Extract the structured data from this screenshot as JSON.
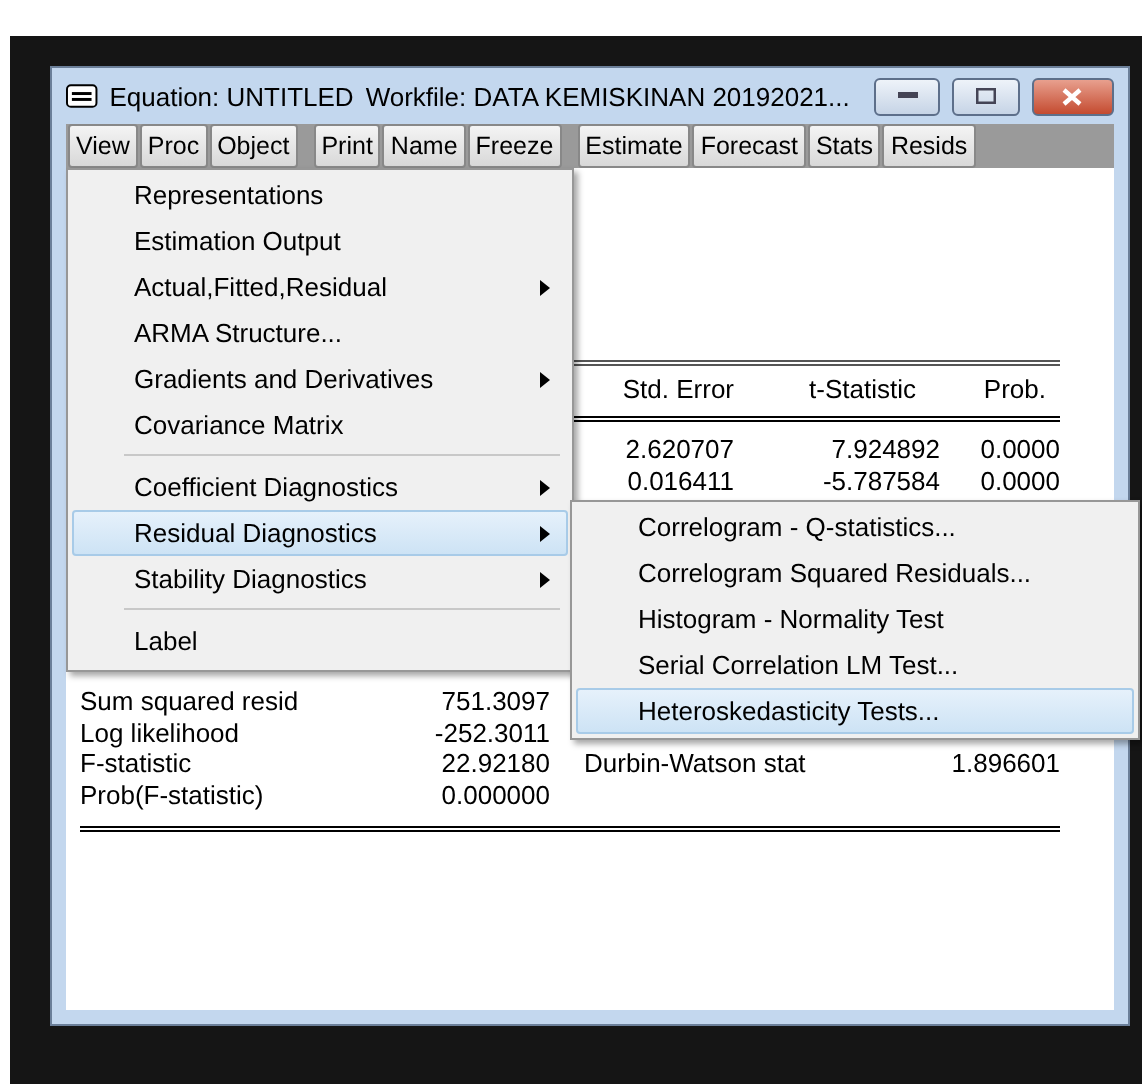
{
  "window": {
    "title": "Equation: UNTITLED",
    "workfile": "Workfile: DATA KEMISKINAN 20192021..."
  },
  "toolbar": [
    [
      "View",
      "Proc",
      "Object"
    ],
    [
      "Print",
      "Name",
      "Freeze"
    ],
    [
      "Estimate",
      "Forecast",
      "Stats",
      "Resids"
    ]
  ],
  "menu": [
    {
      "kind": "item",
      "label": "Representations",
      "has_submenu": false,
      "selected": false
    },
    {
      "kind": "item",
      "label": "Estimation Output",
      "has_submenu": false,
      "selected": false
    },
    {
      "kind": "item",
      "label": "Actual,Fitted,Residual",
      "has_submenu": true,
      "selected": false
    },
    {
      "kind": "item",
      "label": "ARMA Structure...",
      "has_submenu": false,
      "selected": false
    },
    {
      "kind": "item",
      "label": "Gradients and Derivatives",
      "has_submenu": true,
      "selected": false
    },
    {
      "kind": "item",
      "label": "Covariance Matrix",
      "has_submenu": false,
      "selected": false
    },
    {
      "kind": "separator"
    },
    {
      "kind": "item",
      "label": "Coefficient Diagnostics",
      "has_submenu": true,
      "selected": false
    },
    {
      "kind": "item",
      "label": "Residual Diagnostics",
      "has_submenu": true,
      "selected": true
    },
    {
      "kind": "item",
      "label": "Stability Diagnostics",
      "has_submenu": true,
      "selected": false
    },
    {
      "kind": "separator"
    },
    {
      "kind": "item",
      "label": "Label",
      "has_submenu": false,
      "selected": false
    }
  ],
  "submenu": [
    {
      "label": "Correlogram - Q-statistics...",
      "selected": false
    },
    {
      "label": "Correlogram Squared Residuals...",
      "selected": false
    },
    {
      "label": "Histogram - Normality Test",
      "selected": false
    },
    {
      "label": "Serial Correlation LM Test...",
      "selected": false
    },
    {
      "label": "Heteroskedasticity Tests...",
      "selected": true
    }
  ],
  "table": {
    "columns": [
      "Std. Error",
      "t-Statistic",
      "Prob."
    ],
    "rows": [
      [
        "2.620707",
        "7.924892",
        "0.0000"
      ],
      [
        "0.016411",
        "-5.787584",
        "0.0000"
      ]
    ]
  },
  "stats": [
    {
      "label": "Sum squared resid",
      "value": "751.3097"
    },
    {
      "label": "Log likelihood",
      "value": "-252.3011"
    },
    {
      "label": "F-statistic",
      "value": "22.92180",
      "label_2": "Durbin-Watson stat",
      "value_2": "1.896601"
    },
    {
      "label": "Prob(F-statistic)",
      "value": "0.000000"
    }
  ]
}
